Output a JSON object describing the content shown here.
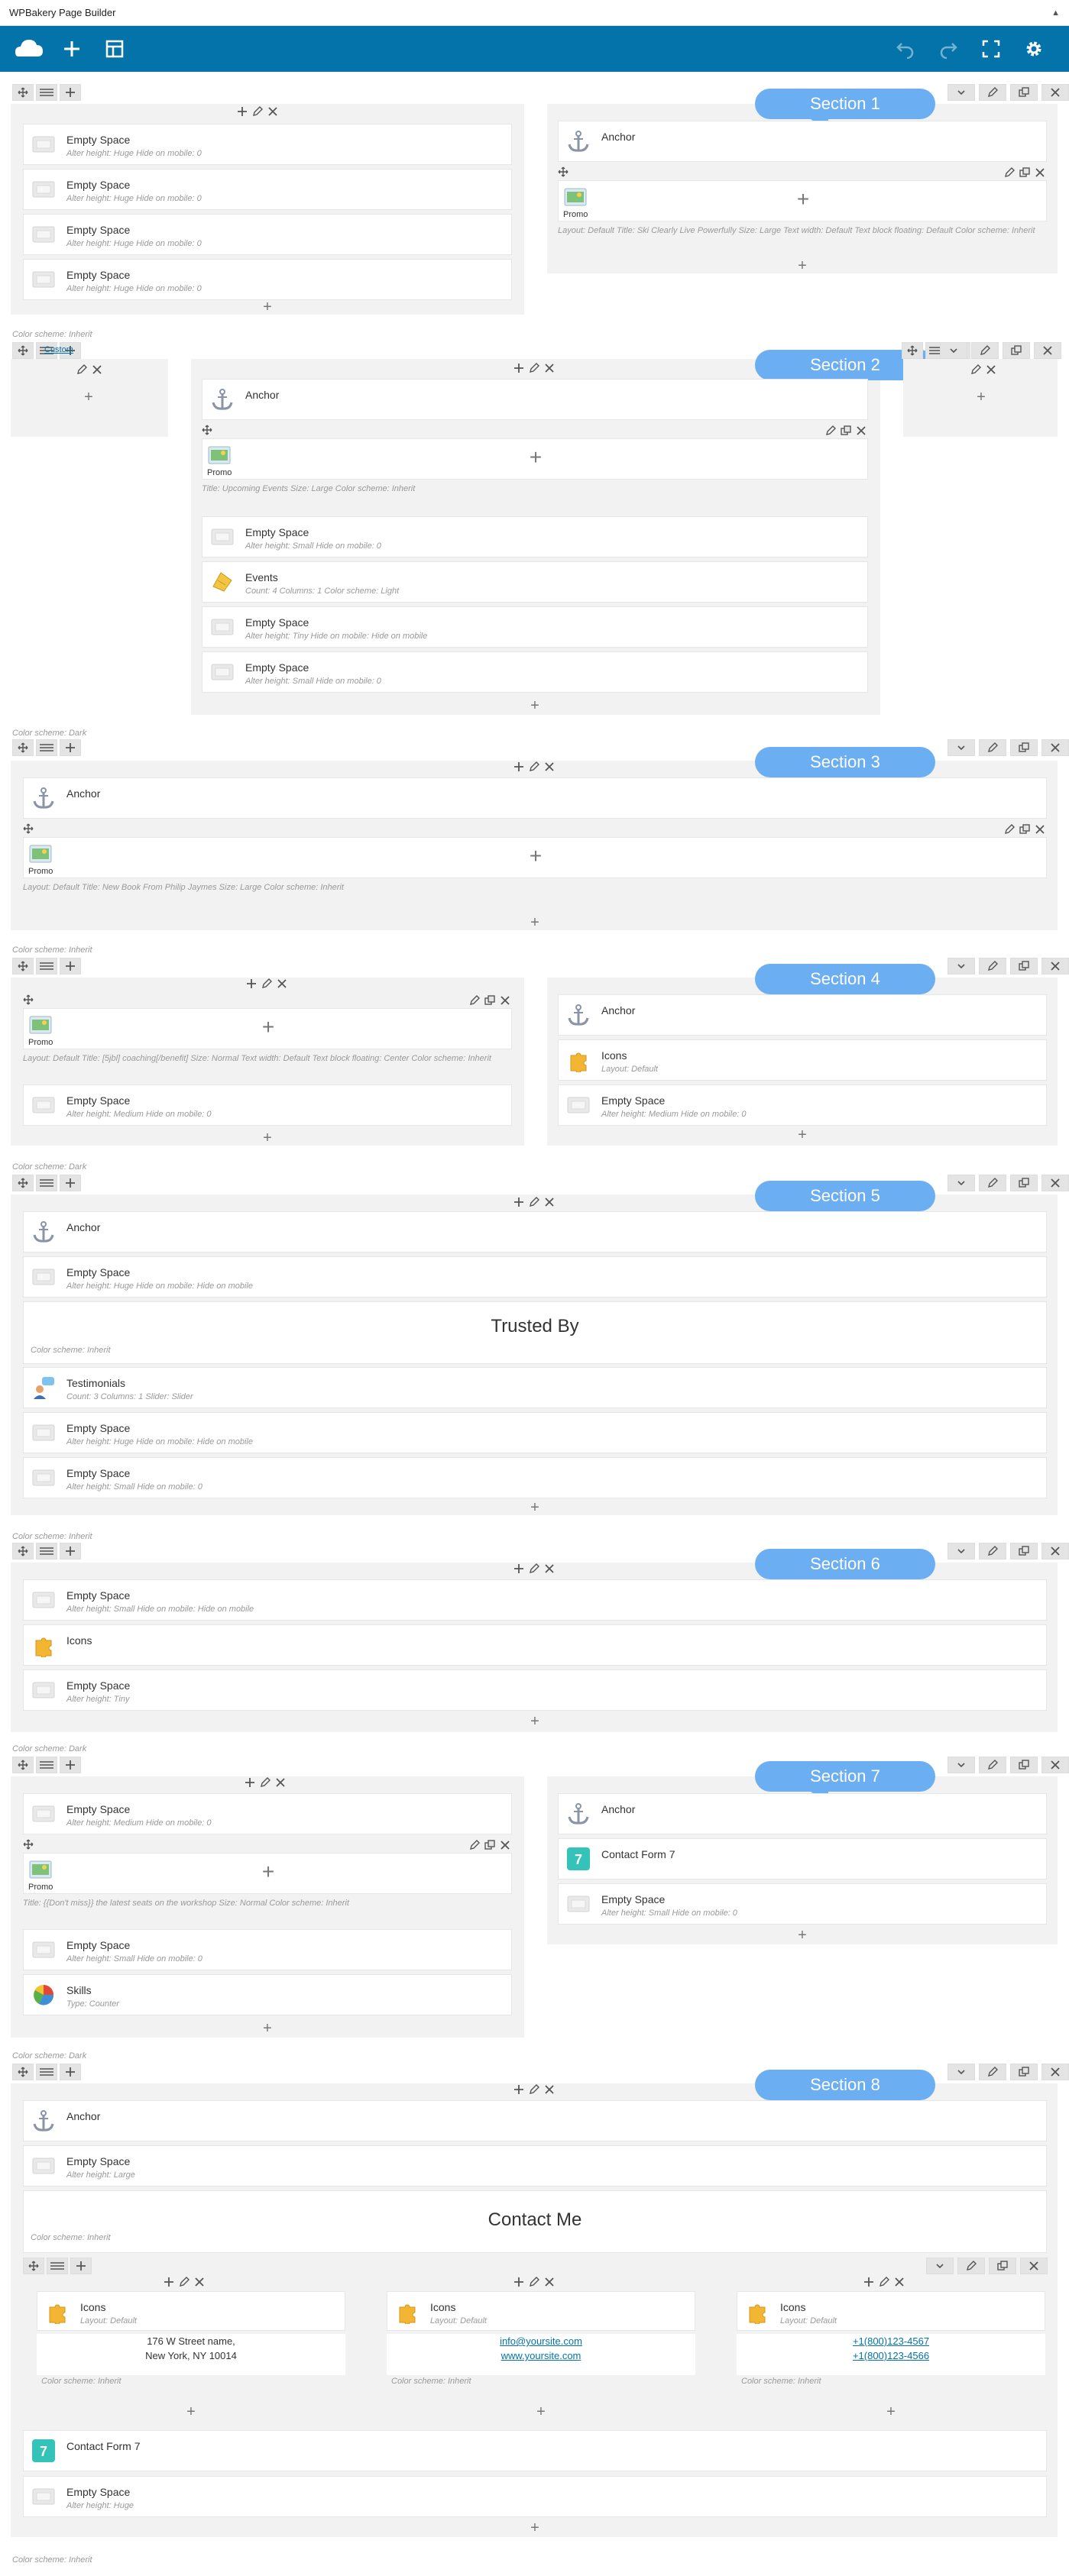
{
  "app": {
    "title": "WPBakery Page Builder",
    "collapse_glyph": "▲"
  },
  "toolbar": {
    "left": [
      {
        "name": "wpbakery-logo-icon"
      },
      {
        "name": "add-element-icon"
      },
      {
        "name": "templates-icon"
      }
    ],
    "right": [
      {
        "name": "undo-icon",
        "dim": true
      },
      {
        "name": "redo-icon",
        "dim": true
      },
      {
        "name": "fullscreen-icon"
      },
      {
        "name": "settings-gear-icon"
      }
    ]
  },
  "labels": {
    "cs_inherit": "Color scheme: Inherit",
    "cs_dark": "Color scheme: Dark",
    "custom_link": "Custom"
  },
  "sections": [
    {
      "callout": "Section 1",
      "color_scheme": ""
    },
    {
      "callout": "Section 2",
      "color_scheme": "Color scheme: Inherit"
    },
    {
      "callout": "Section 3",
      "color_scheme": "Color scheme: Dark"
    },
    {
      "callout": "Section 4",
      "color_scheme": "Color scheme: Inherit"
    },
    {
      "callout": "Section 5",
      "color_scheme": "Color scheme: Dark"
    },
    {
      "callout": "Section 6",
      "color_scheme": "Color scheme: Inherit"
    },
    {
      "callout": "Section 7",
      "color_scheme": "Color scheme: Dark"
    },
    {
      "callout": "Section 8",
      "color_scheme": "Color scheme: Dark"
    }
  ],
  "el": {
    "es_huge": {
      "title": "Empty Space",
      "sub": "Alter height: Huge  Hide on mobile: 0"
    },
    "anchor": {
      "title": "Anchor",
      "sub": ""
    },
    "promo": {
      "title": "Promo"
    },
    "s1_promo_meta": "Layout: Default  Title: Ski Clearly Live Powerfully  Size: Large  Text width: Default  Text block floating: Default  Color scheme: Inherit",
    "s2_promo_meta": "Title: Upcoming Events  Size: Large  Color scheme: Inherit",
    "s2_es1": {
      "title": "Empty Space",
      "sub": "Alter height: Small  Hide on mobile: 0"
    },
    "s2_events": {
      "title": "Events",
      "sub": "Count: 4  Columns: 1  Color scheme: Light"
    },
    "s2_es2": {
      "title": "Empty Space",
      "sub": "Alter height: Tiny  Hide on mobile: Hide on mobile"
    },
    "s2_es3": {
      "title": "Empty Space",
      "sub": "Alter height: Small  Hide on mobile: 0"
    },
    "s3_promo_meta": "Layout: Default  Title: New Book From Philip Jaymes  Size: Large  Color scheme: Inherit",
    "s4_promo_meta": "Layout: Default  Title: [5jbl] coaching[/benefit]  Size: Normal  Text width: Default  Text block floating: Center  Color scheme: Inherit",
    "s4_es_medium": {
      "title": "Empty Space",
      "sub": "Alter height: Medium  Hide on mobile: 0"
    },
    "s4_icons": {
      "title": "Icons",
      "sub": "Layout: Default"
    },
    "s5_es1": {
      "title": "Empty Space",
      "sub": "Alter height: Huge  Hide on mobile: Hide on mobile"
    },
    "s5_trusted": "Trusted By",
    "s5_testimonials": {
      "title": "Testimonials",
      "sub": "Count: 3  Columns: 1  Slider: Slider"
    },
    "s5_es2": {
      "title": "Empty Space",
      "sub": "Alter height: Huge  Hide on mobile: Hide on mobile"
    },
    "s5_es3": {
      "title": "Empty Space",
      "sub": "Alter height: Small  Hide on mobile: 0"
    },
    "s6_es1": {
      "title": "Empty Space",
      "sub": "Alter height: Small  Hide on mobile: Hide on mobile"
    },
    "s6_icons": {
      "title": "Icons",
      "sub": ""
    },
    "s6_es2": {
      "title": "Empty Space",
      "sub": "Alter height: Tiny"
    },
    "s7_es1": {
      "title": "Empty Space",
      "sub": "Alter height: Medium  Hide on mobile: 0"
    },
    "s7_promo_meta": "Title: {{Don't miss}} the latest seats on the workshop  Size: Normal  Color scheme: Inherit",
    "s7_es2": {
      "title": "Empty Space",
      "sub": "Alter height: Small  Hide on mobile: 0"
    },
    "s7_skills": {
      "title": "Skills",
      "sub": "Type: Counter"
    },
    "s7_cf7": {
      "title": "Contact Form 7",
      "sub": ""
    },
    "s7_es3": {
      "title": "Empty Space",
      "sub": "Alter height: Small  Hide on mobile: 0"
    },
    "s8_es1": {
      "title": "Empty Space",
      "sub": "Alter height: Large"
    },
    "s8_contact": "Contact Me",
    "s8_icons": {
      "title": "Icons",
      "sub": "Layout: Default"
    },
    "s8_addr1": "176 W Street name,",
    "s8_addr2": "New York, NY 10014",
    "s8_mail": "info@yoursite.com",
    "s8_web": "www.yoursite.com",
    "s8_phone1": "+1(800)123-4567",
    "s8_phone2": "+1(800)123-4566",
    "s8_cf7": {
      "title": "Contact Form 7",
      "sub": ""
    },
    "s8_es2": {
      "title": "Empty Space",
      "sub": "Alter height: Huge"
    }
  }
}
